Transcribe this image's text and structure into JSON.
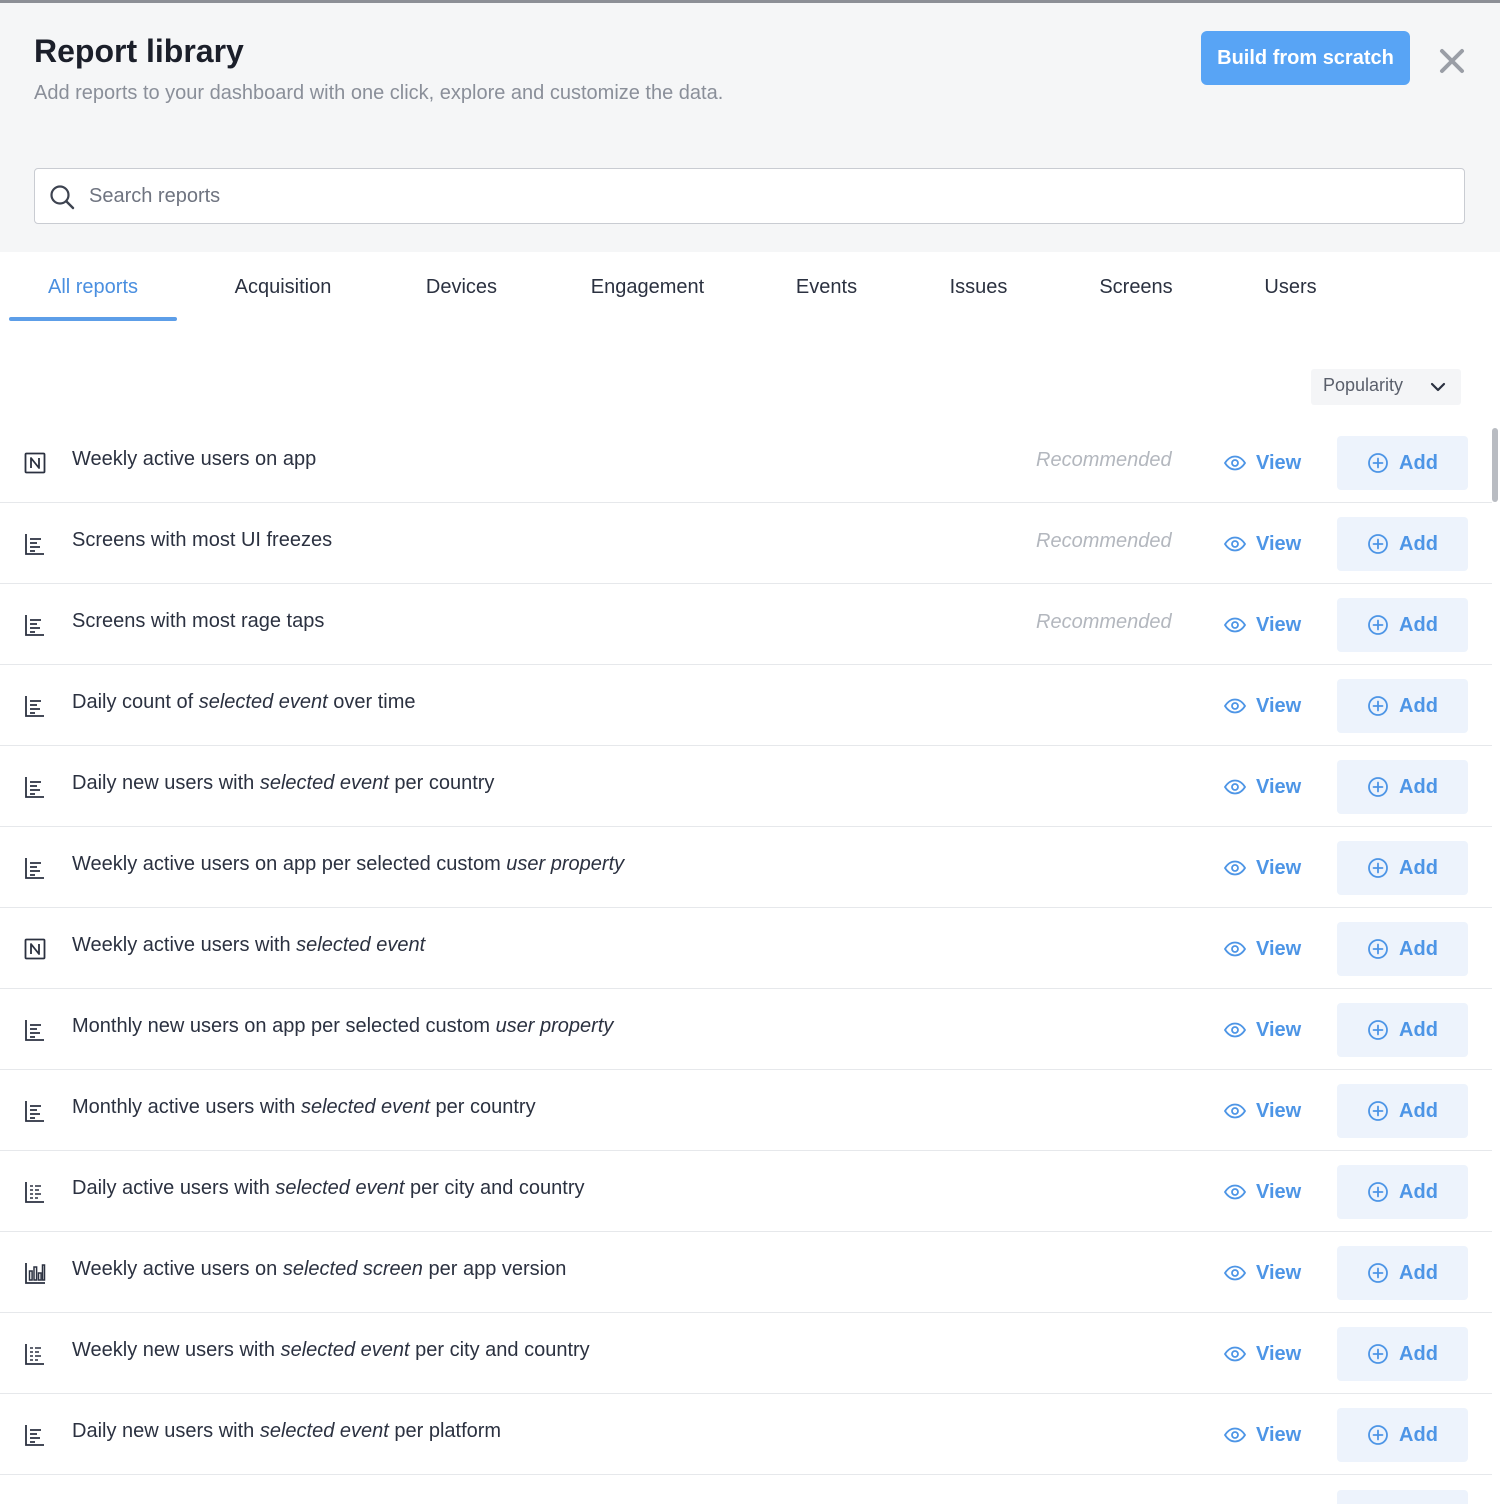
{
  "header": {
    "title": "Report library",
    "subtitle": "Add reports to your dashboard with one click, explore and customize the data.",
    "build_label": "Build from scratch"
  },
  "search": {
    "placeholder": "Search reports",
    "value": ""
  },
  "tabs": [
    "All reports",
    "Acquisition",
    "Devices",
    "Engagement",
    "Events",
    "Issues",
    "Screens",
    "Users"
  ],
  "active_tab": "All reports",
  "sort": {
    "label": "Popularity"
  },
  "actions": {
    "view_label": "View",
    "add_label": "Add"
  },
  "colors": {
    "accent": "#4d95e6",
    "primary_button": "#58a4f5",
    "add_bg": "#edf3fc"
  },
  "reports": [
    {
      "icon": "number-icon",
      "parts": [
        {
          "t": "Weekly active users on app"
        }
      ],
      "tag": "Recommended"
    },
    {
      "icon": "bar-list-icon",
      "parts": [
        {
          "t": "Screens with most UI freezes"
        }
      ],
      "tag": "Recommended"
    },
    {
      "icon": "bar-list-icon",
      "parts": [
        {
          "t": "Screens with most rage taps"
        }
      ],
      "tag": "Recommended"
    },
    {
      "icon": "bar-list-icon",
      "parts": [
        {
          "t": "Daily count of "
        },
        {
          "t": "selected event",
          "i": true
        },
        {
          "t": " over time"
        }
      ],
      "tag": ""
    },
    {
      "icon": "bar-list-icon",
      "parts": [
        {
          "t": "Daily new users with "
        },
        {
          "t": "selected event",
          "i": true
        },
        {
          "t": " per country"
        }
      ],
      "tag": ""
    },
    {
      "icon": "bar-list-icon",
      "parts": [
        {
          "t": "Weekly active users on app per selected custom "
        },
        {
          "t": "user property",
          "i": true
        }
      ],
      "tag": ""
    },
    {
      "icon": "number-icon",
      "parts": [
        {
          "t": "Weekly active users with "
        },
        {
          "t": "selected event",
          "i": true
        }
      ],
      "tag": ""
    },
    {
      "icon": "bar-list-icon",
      "parts": [
        {
          "t": "Monthly new users on app per selected custom "
        },
        {
          "t": "user property",
          "i": true
        }
      ],
      "tag": ""
    },
    {
      "icon": "bar-list-icon",
      "parts": [
        {
          "t": "Monthly active users with "
        },
        {
          "t": "selected event",
          "i": true
        },
        {
          "t": " per country"
        }
      ],
      "tag": ""
    },
    {
      "icon": "table-list-icon",
      "parts": [
        {
          "t": "Daily active users with "
        },
        {
          "t": "selected event",
          "i": true
        },
        {
          "t": " per city and country"
        }
      ],
      "tag": ""
    },
    {
      "icon": "column-chart-icon",
      "parts": [
        {
          "t": "Weekly active users on "
        },
        {
          "t": "selected screen",
          "i": true
        },
        {
          "t": " per app version"
        }
      ],
      "tag": ""
    },
    {
      "icon": "table-list-icon",
      "parts": [
        {
          "t": "Weekly new users with "
        },
        {
          "t": "selected event",
          "i": true
        },
        {
          "t": " per city and country"
        }
      ],
      "tag": ""
    },
    {
      "icon": "bar-list-icon",
      "parts": [
        {
          "t": "Daily new users with "
        },
        {
          "t": "selected event",
          "i": true
        },
        {
          "t": " per platform"
        }
      ],
      "tag": ""
    }
  ]
}
